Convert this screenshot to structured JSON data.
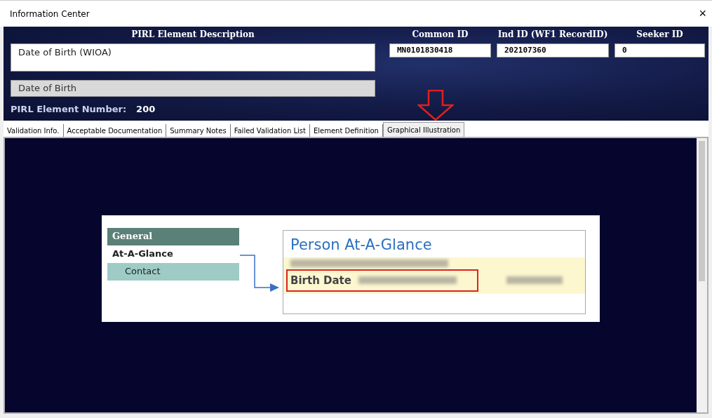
{
  "window": {
    "title": "Information Center",
    "close": "×"
  },
  "header": {
    "description_label": "PIRL Element Description",
    "description": "Date of Birth (WIOA)",
    "short_name": "Date of Birth",
    "number_label": "PIRL Element Number:",
    "number": "200",
    "ids": [
      {
        "label": "Common ID",
        "value": "MN0101830418"
      },
      {
        "label": "Ind ID (WF1 RecordID)",
        "value": "202107360"
      },
      {
        "label": "Seeker ID",
        "value": "0"
      }
    ]
  },
  "tabs": [
    {
      "label": "Validation Info.",
      "selected": false
    },
    {
      "label": "Acceptable Documentation",
      "selected": false
    },
    {
      "label": "Summary Notes",
      "selected": false
    },
    {
      "label": "Failed Validation List",
      "selected": false
    },
    {
      "label": "Element Definition",
      "selected": false
    },
    {
      "label": "Graphical Illustration",
      "selected": true
    }
  ],
  "illustration": {
    "menu_header": "General",
    "menu_items": [
      {
        "label": "At-A-Glance",
        "selected": true
      },
      {
        "label": "Contact",
        "selected": false
      }
    ],
    "card_title": "Person At-A-Glance",
    "field_label": "Birth Date"
  }
}
